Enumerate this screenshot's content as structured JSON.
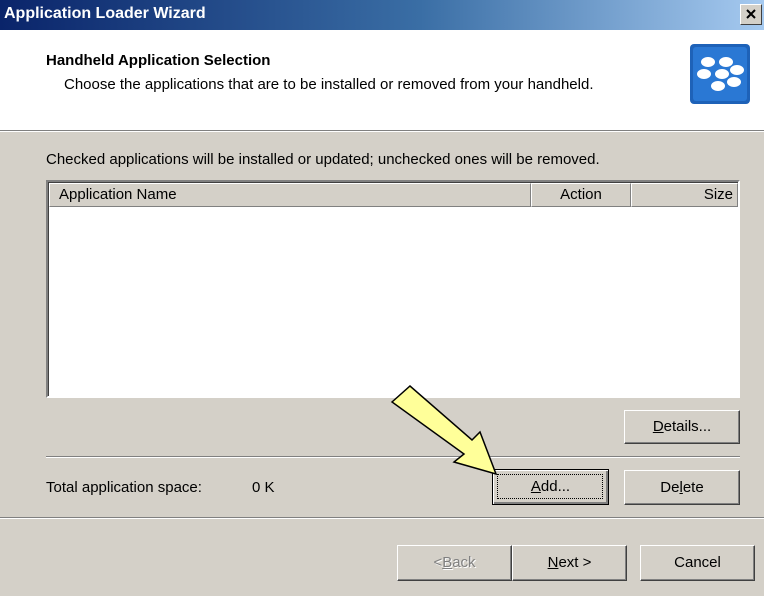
{
  "window": {
    "title": "Application Loader Wizard"
  },
  "header": {
    "title": "Handheld Application Selection",
    "subtitle": "Choose the applications that are to be installed or removed from your handheld.",
    "logo_icon": "blackberry-logo-icon"
  },
  "instructions": "Checked applications will be installed or updated; unchecked ones will be removed.",
  "app_list": {
    "columns": [
      "Application Name",
      "Action",
      "Size"
    ],
    "rows": []
  },
  "buttons": {
    "details": {
      "pre": "",
      "key": "D",
      "post": "etails..."
    },
    "add": {
      "pre": "",
      "key": "A",
      "post": "dd..."
    },
    "delete": {
      "pre": "De",
      "key": "l",
      "post": "ete"
    },
    "back": {
      "pre": "< ",
      "key": "B",
      "post": "ack"
    },
    "next": {
      "pre": "",
      "key": "N",
      "post": "ext >"
    },
    "cancel": "Cancel"
  },
  "space": {
    "label": "Total application space:",
    "value": "0 K"
  },
  "colors": {
    "titlebar_start": "#0a246a",
    "titlebar_end": "#a6caf0",
    "dialog_bg": "#d4d0c8",
    "annotation_arrow": "#ffff99"
  }
}
